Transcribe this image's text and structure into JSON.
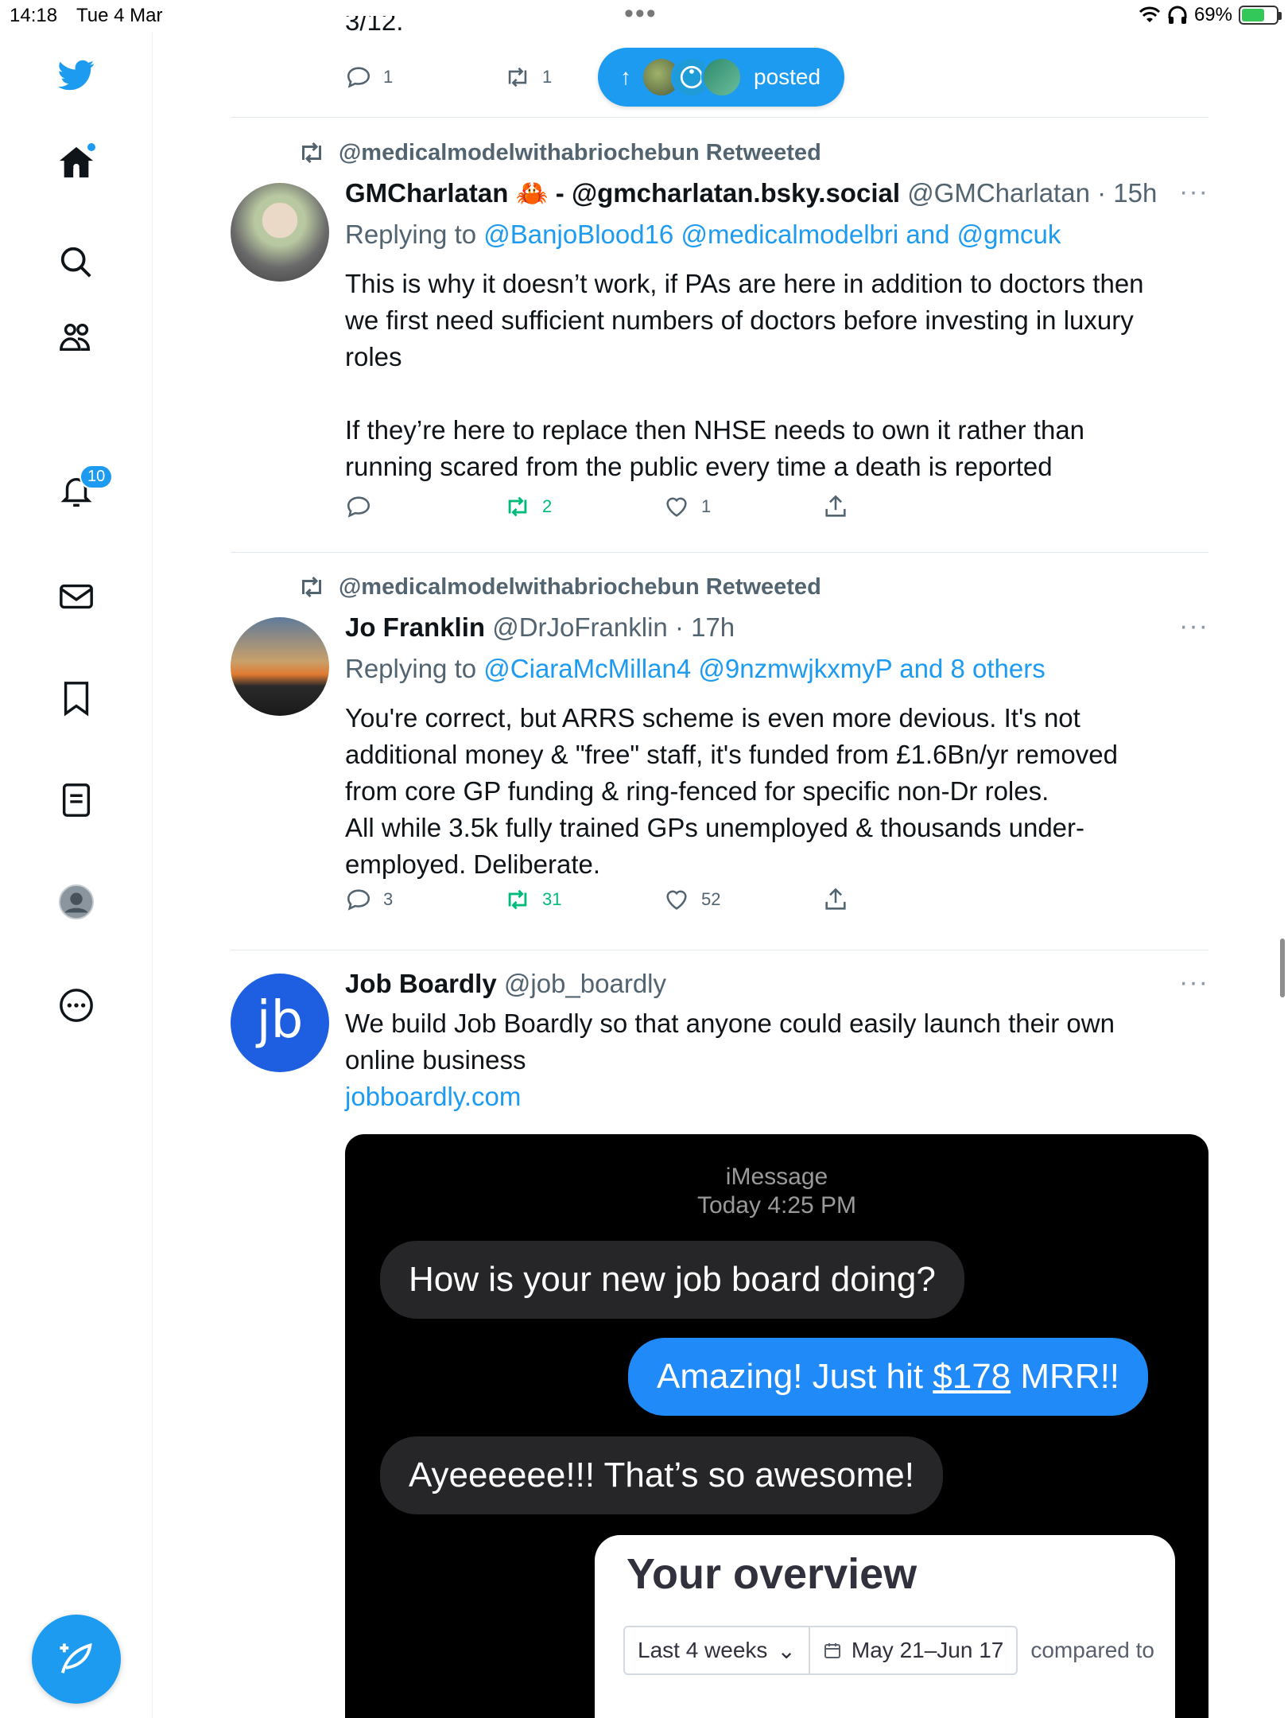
{
  "status_bar": {
    "time": "14:18",
    "date": "Tue 4 Mar",
    "battery": "69%"
  },
  "sidebar": {
    "items": [
      {
        "name": "twitter-logo"
      },
      {
        "name": "home"
      },
      {
        "name": "explore"
      },
      {
        "name": "communities"
      },
      {
        "name": "notifications",
        "badge": "10"
      },
      {
        "name": "messages"
      },
      {
        "name": "bookmarks"
      },
      {
        "name": "lists"
      },
      {
        "name": "profile"
      },
      {
        "name": "more"
      }
    ]
  },
  "posted_pill": {
    "label": "posted"
  },
  "top_tweet": {
    "partial_text": "3/12.",
    "replies": "1",
    "retweets": "1"
  },
  "tweets": [
    {
      "retweeted_by": "@medicalmodelwithabriochebun Retweeted",
      "name": "GMCharlatan 🦀 - @gmcharlatan.bsky.social",
      "handle": "@GMCharlatan",
      "time": "· 15h",
      "replying_prefix": "Replying to",
      "replying_to": "@BanjoBlood16 @medicalmodelbri and @gmcuk",
      "text": "This is why it doesn’t work, if PAs are here in addition to doctors then\nwe first need sufficient numbers of doctors before investing in luxury\nroles\n\nIf they’re here to replace then NHSE needs to own it rather than\nrunning scared from the public every time a death is reported",
      "replies": "",
      "retweets": "2",
      "likes": "1"
    },
    {
      "retweeted_by": "@medicalmodelwithabriochebun Retweeted",
      "name": "Jo Franklin",
      "handle": "@DrJoFranklin",
      "time": "· 17h",
      "replying_prefix": "Replying to",
      "replying_to": "@CiaraMcMillan4 @9nzmwjkxmyP and 8 others",
      "text": "You're correct, but ARRS scheme is even more devious. It's not\nadditional money & \"free\" staff, it's funded from £1.6Bn/yr removed\nfrom core GP funding & ring-fenced for specific non-Dr roles.\nAll while 3.5k fully trained GPs unemployed & thousands under-\nemployed. Deliberate.",
      "replies": "3",
      "retweets": "31",
      "likes": "52"
    },
    {
      "name": "Job Boardly",
      "handle": "@job_boardly",
      "avatar_text": "jb",
      "text": "We build Job Boardly so that anyone could easily launch their own\nonline business",
      "link": "jobboardly.com"
    }
  ],
  "media": {
    "header": "iMessage",
    "subheader": "Today 4:25 PM",
    "msg1": "How is your new job board doing?",
    "msg2_pre": "Amazing! Just hit ",
    "msg2_amount": "$178",
    "msg2_post": " MRR!!",
    "msg3": "Ayeeeeee!!! That’s so awesome!",
    "overview_title": "Your overview",
    "range": "Last 4 weeks",
    "dates": "May 21–Jun 17",
    "compared": "compared to"
  },
  "colors": {
    "accent": "#1d9bf0",
    "retweet_green": "#00ba7c",
    "muted": "#536471"
  }
}
